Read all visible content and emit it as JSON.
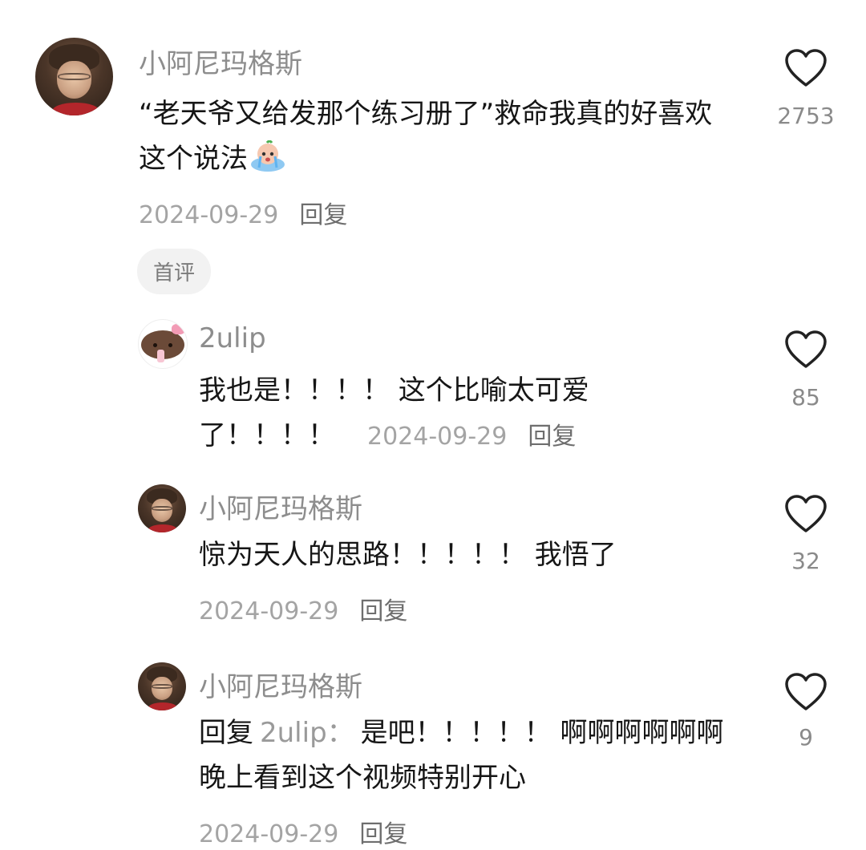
{
  "comments": [
    {
      "user": "小阿尼玛格斯",
      "text": "“老天爷又给发那个练习册了”救命我真的好喜欢这个说法",
      "emoji": "crying-baby-emoji",
      "date": "2024-09-29",
      "reply_label": "回复",
      "likes": "2753",
      "badge": "首评"
    }
  ],
  "replies": [
    {
      "user": "2ulip",
      "text": "我也是！！！！ 这个比喻太可爱了！！！！",
      "date": "2024-09-29",
      "reply_label": "回复",
      "likes": "85"
    },
    {
      "user": "小阿尼玛格斯",
      "text": "惊为天人的思路！！！！！ 我悟了",
      "date": "2024-09-29",
      "reply_label": "回复",
      "likes": "32"
    },
    {
      "user": "小阿尼玛格斯",
      "reply_prefix": "回复",
      "reply_to": "2ulip：",
      "text": "是吧！！！！！ 啊啊啊啊啊啊晚上看到这个视频特别开心",
      "date": "2024-09-29",
      "reply_label": "回复",
      "likes": "9"
    }
  ],
  "colors": {
    "name": "#8d8d8d",
    "text": "#161616",
    "date": "#a4a4a4",
    "badge_bg": "#f2f2f2"
  }
}
